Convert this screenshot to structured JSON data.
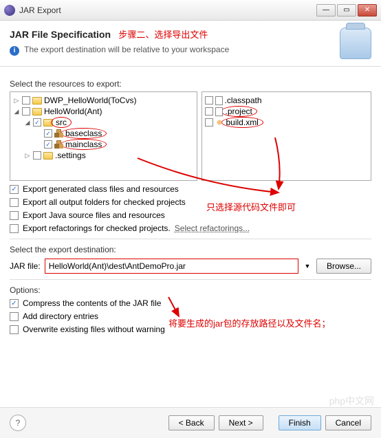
{
  "window": {
    "title": "JAR Export"
  },
  "header": {
    "title": "JAR File Specification",
    "annotation": "步骤二、选择导出文件",
    "subtitle": "The export destination will be relative to your workspace"
  },
  "resources": {
    "label": "Select the resources to export:",
    "left_tree": [
      {
        "exp": "▷",
        "chk": false,
        "icon": "folder",
        "label": "DWP_HelloWorld(ToCvs)",
        "indent": 0
      },
      {
        "exp": "◢",
        "chk": false,
        "icon": "folder",
        "label": "HelloWorld(Ant)",
        "indent": 0
      },
      {
        "exp": "◢",
        "chk": true,
        "icon": "folder",
        "label": "src",
        "indent": 1,
        "hl": true
      },
      {
        "exp": "",
        "chk": true,
        "icon": "package",
        "label": "baseclass",
        "indent": 2,
        "hl": true
      },
      {
        "exp": "",
        "chk": true,
        "icon": "package",
        "label": "mainclass",
        "indent": 2,
        "hl": true
      },
      {
        "exp": "▷",
        "chk": false,
        "icon": "folder",
        "label": ".settings",
        "indent": 1
      }
    ],
    "right_tree": [
      {
        "chk": false,
        "icon": "file",
        "label": ".classpath"
      },
      {
        "chk": false,
        "icon": "file",
        "label": ".project",
        "hl": true
      },
      {
        "chk": false,
        "icon": "ant",
        "label": "build.xml",
        "hl": true
      }
    ]
  },
  "options": {
    "export_generated": {
      "checked": true,
      "label": "Export generated class files and resources"
    },
    "export_output": {
      "checked": false,
      "label": "Export all output folders for checked projects"
    },
    "export_source": {
      "checked": false,
      "label": "Export Java source files and resources"
    },
    "export_refactor": {
      "checked": false,
      "label": "Export refactorings for checked projects.",
      "link": "Select refactorings..."
    }
  },
  "annotations": {
    "source_only": "只选择源代码文件即可",
    "jar_path": "将要生成的jar包的存放路径以及文件名；"
  },
  "destination": {
    "label": "Select the export destination:",
    "field_label": "JAR file:",
    "value": "HelloWorld(Ant)\\dest\\AntDemoPro.jar",
    "browse": "Browse..."
  },
  "opts2": {
    "label": "Options:",
    "compress": {
      "checked": true,
      "label": "Compress the contents of the JAR file"
    },
    "adddir": {
      "checked": false,
      "label": "Add directory entries"
    },
    "overwrite": {
      "checked": false,
      "label": "Overwrite existing files without warning"
    }
  },
  "footer": {
    "back": "< Back",
    "next": "Next >",
    "finish": "Finish",
    "cancel": "Cancel"
  },
  "watermark": "php中文网"
}
